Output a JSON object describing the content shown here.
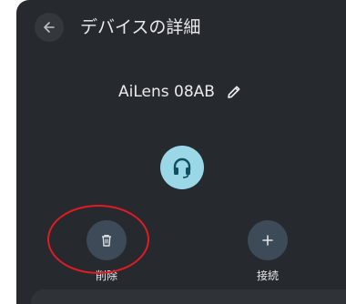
{
  "header": {
    "back_icon": "arrow-left-icon",
    "title": "デバイスの詳細"
  },
  "device": {
    "name": "AiLens 08AB",
    "edit_icon": "pencil-icon",
    "avatar_icon": "headset-icon",
    "avatar_color": "#9ad8e8"
  },
  "actions": {
    "delete": {
      "label": "削除",
      "icon": "trash-icon"
    },
    "connect": {
      "label": "接続",
      "icon": "plus-icon"
    }
  },
  "colors": {
    "background": "#262a2e",
    "action_circle": "#3d4a57",
    "highlight": "#e01b24",
    "text": "#e8eaed"
  }
}
